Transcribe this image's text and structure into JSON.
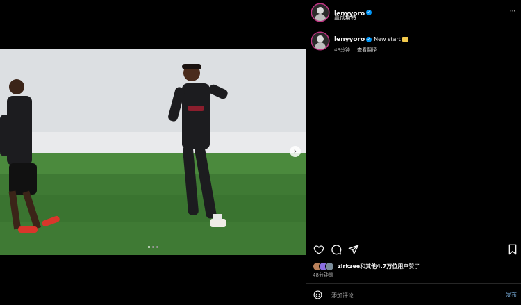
{
  "post": {
    "username": "lenyyoro",
    "location": "曼彻斯特",
    "caption": "New start",
    "time_ago": "48分钟",
    "translate_label": "查看翻译"
  },
  "carousel": {
    "slide_count": 3,
    "active_index": 0
  },
  "likes": {
    "user": "zirkzee",
    "connector": "和",
    "others": "其他4.7万位用户",
    "suffix": "赞了"
  },
  "post_time": "48分钟前",
  "comment": {
    "placeholder": "添加评论...",
    "post_label": "发布"
  },
  "colors": {
    "verified": "#0095f6",
    "post_button": "#6f9fc9",
    "pitch": "#3f7a34",
    "kit": "#1c1c1f"
  }
}
